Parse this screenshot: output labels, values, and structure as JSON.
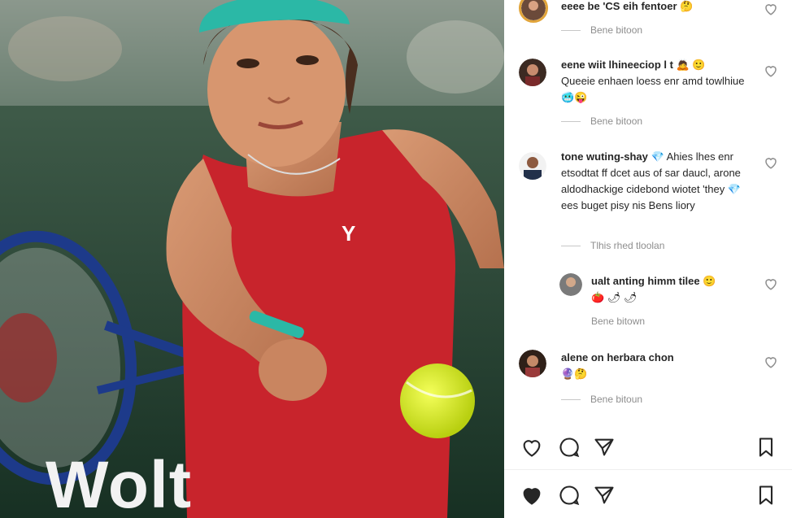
{
  "post": {
    "watermark": "Wolt"
  },
  "comments": [
    {
      "user": "",
      "text": "eeee be 'CS eih fentoer 🤔",
      "replies": "Bene bitoon",
      "avatar": "ring-avatar"
    },
    {
      "user": "eene wiit lhineeciop l t 🙇 🙂",
      "text": "Queeie enhaen loess enr amd towlhiue 🥶😜",
      "replies": "Bene bitoon",
      "avatar": "woman-avatar"
    },
    {
      "user": "tone wuting-shay 💎",
      "text": "Ahies lhes enr etsodtat ff dcet aus of sar daucl, arone aldodhackige cidebond wiotet 'they 💎 ees buget pisy nis Bens liory",
      "replies": "Tlhis rhed tloolan",
      "avatar": "man-avatar"
    },
    {
      "user": "ualt anting himm tilee 🙂",
      "text": "🍅 🌶 🌶",
      "replies": "Bene bitown",
      "avatar": "reply-avatar"
    },
    {
      "user": "alene on herbara chon",
      "text": "🔮🤔",
      "replies": "Bene bitoun",
      "avatar": "woman2-avatar"
    }
  ],
  "colors": {
    "text": "#262626",
    "muted": "#8e8e8e",
    "liked": "#262626",
    "cap": "#2bb8a6",
    "shirt": "#c8242c"
  },
  "icons": [
    "heart-icon",
    "comment-icon",
    "share-icon",
    "bookmark-icon"
  ]
}
